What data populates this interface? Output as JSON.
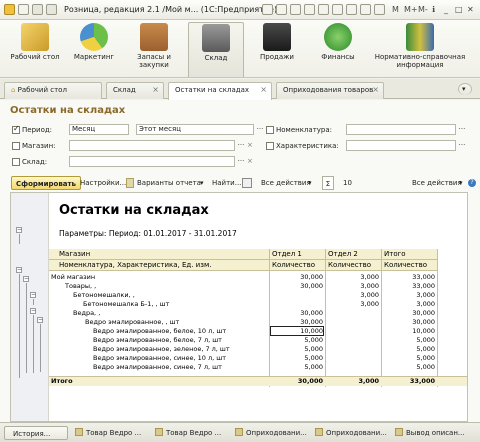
{
  "window": {
    "title": "Розница, редакция 2.1 /Мой м... (1С:Предприятие)",
    "m_labels": [
      "M",
      "M+",
      "M-"
    ]
  },
  "sections": [
    {
      "label": "Рабочий стол"
    },
    {
      "label": "Маркетинг"
    },
    {
      "label": "Запасы и закупки"
    },
    {
      "label": "Склад"
    },
    {
      "label": "Продажи"
    },
    {
      "label": "Финансы"
    },
    {
      "label": "Нормативно-справочная информация"
    }
  ],
  "tabs": [
    {
      "label": "Рабочий стол"
    },
    {
      "label": "Склад"
    },
    {
      "label": "Остатки на складах"
    },
    {
      "label": "Оприходования товаров"
    }
  ],
  "form": {
    "title": "Остатки на складах",
    "period_label": "Период:",
    "period_kind": "Месяц",
    "period_value": "Этот месяц",
    "store_label": "Магазин:",
    "warehouse_label": "Склад:",
    "nomenclature_label": "Номенклатура:",
    "characteristic_label": "Характеристика:",
    "dots": "...",
    "x_mark": "×"
  },
  "toolbar": {
    "generate": "Сформировать",
    "settings": "Настройки...",
    "variants": "Варианты отчета",
    "find": "Найти...",
    "all_actions": "Все действия",
    "sum_count": "10",
    "all_actions_right": "Все действия"
  },
  "report": {
    "title": "Остатки на складах",
    "params": "Параметры:    Период: 01.01.2017 - 31.01.2017",
    "h_store": "Магазин",
    "h_nomen": "Номенклатура, Характеристика, Ед. изм.",
    "h_dept1": "Отдел 1",
    "h_dept2": "Отдел 2",
    "h_total": "Итого",
    "h_qty": "Количество",
    "rows": [
      {
        "name": "Мой магазин",
        "d1": "30,000",
        "d2": "3,000",
        "t": "33,000"
      },
      {
        "name": "Товары, ,",
        "d1": "30,000",
        "d2": "3,000",
        "t": "33,000"
      },
      {
        "name": "Бетономешалки, ,",
        "d1": "",
        "d2": "3,000",
        "t": "3,000"
      },
      {
        "name": "Бетономешалка Б-1, , шт",
        "d1": "",
        "d2": "3,000",
        "t": "3,000"
      },
      {
        "name": "Ведра, ,",
        "d1": "30,000",
        "d2": "",
        "t": "30,000"
      },
      {
        "name": "Ведро эмалированное, , шт",
        "d1": "30,000",
        "d2": "",
        "t": "30,000"
      },
      {
        "name": "Ведро эмалированное, белое, 10 л, шт",
        "d1": "10,000",
        "d2": "",
        "t": "10,000"
      },
      {
        "name": "Ведро эмалированное, белое, 7 л, шт",
        "d1": "5,000",
        "d2": "",
        "t": "5,000"
      },
      {
        "name": "Ведро эмалированное, зеленое, 7 л, шт",
        "d1": "5,000",
        "d2": "",
        "t": "5,000"
      },
      {
        "name": "Ведро эмалированное, синее, 10 л, шт",
        "d1": "5,000",
        "d2": "",
        "t": "5,000"
      },
      {
        "name": "Ведро эмалированное, синее, 7 л, шт",
        "d1": "5,000",
        "d2": "",
        "t": "5,000"
      }
    ],
    "total_label": "Итого",
    "total_d1": "30,000",
    "total_d2": "3,000",
    "total_t": "33,000"
  },
  "taskbar": [
    {
      "label": "История..."
    },
    {
      "label": "Товар Ведро ..."
    },
    {
      "label": "Товар Ведро ..."
    },
    {
      "label": "Оприходовани..."
    },
    {
      "label": "Оприходовани..."
    },
    {
      "label": "Вывод описан..."
    }
  ],
  "colors": {
    "accent": "#f3d86e",
    "header_fill": "#f4f0d0",
    "title_brown": "#8a6a2a"
  }
}
